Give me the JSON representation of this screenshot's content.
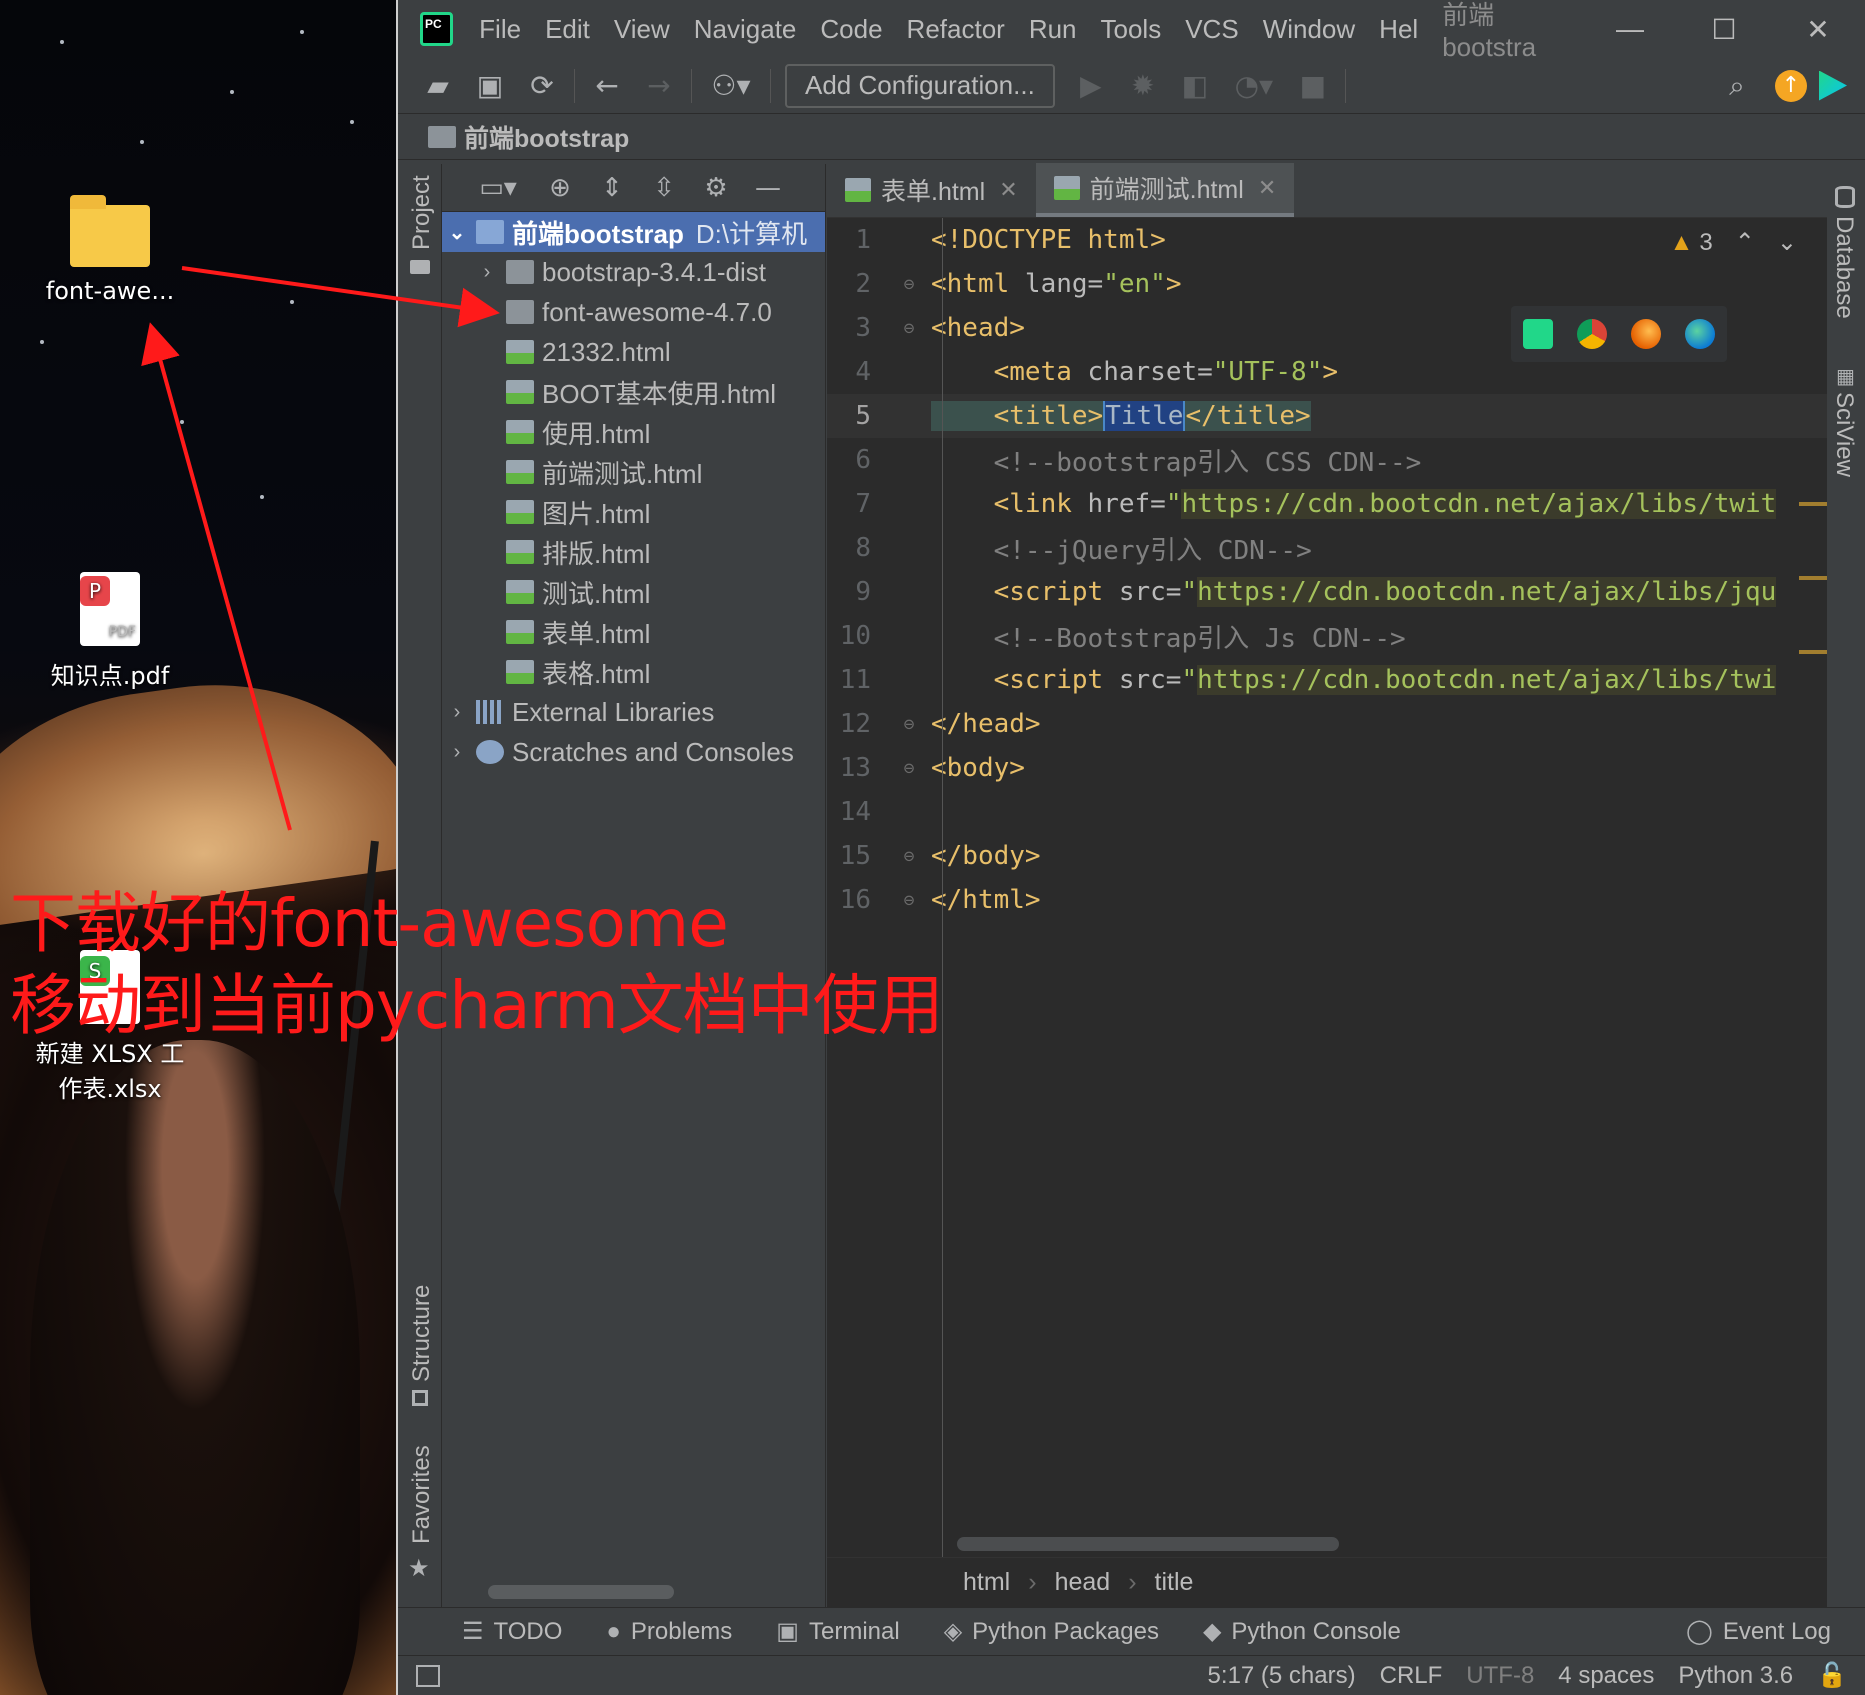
{
  "desktop": {
    "icons": [
      {
        "label": "font-awe..."
      },
      {
        "label": "知识点.pdf",
        "badge": "P",
        "type_label": "PDF"
      },
      {
        "label_line1": "新建 XLSX 工",
        "label_line2": "作表.xlsx",
        "badge": "S"
      }
    ],
    "annotation_line1": "下载好的font-awesome",
    "annotation_line2": "移动到当前pycharm文档中使用",
    "annotation_color": "#ff1a1a"
  },
  "titlebar": {
    "logo": "PC",
    "menu": [
      "File",
      "Edit",
      "View",
      "Navigate",
      "Code",
      "Refactor",
      "Run",
      "Tools",
      "VCS",
      "Window",
      "Hel"
    ],
    "window_title": "前端bootstra",
    "controls": [
      "—",
      "☐",
      "✕"
    ]
  },
  "toolbar": {
    "add_configuration": "Add Configuration...",
    "icons": [
      "open-folder-icon",
      "save-icon",
      "sync-icon",
      "back-icon",
      "forward-icon",
      "user-icon",
      "run-icon",
      "debug-icon",
      "coverage-icon",
      "profile-icon",
      "stop-icon",
      "search-icon",
      "update-icon"
    ]
  },
  "navbar": {
    "project": "前端bootstrap"
  },
  "left_stripe": {
    "project": "Project",
    "structure": "Structure",
    "favorites": "Favorites"
  },
  "right_stripe": {
    "database": "Database",
    "sciview": "SciView"
  },
  "project_tree": {
    "root": {
      "name": "前端bootstrap",
      "path": "D:\\计算机"
    },
    "items": [
      {
        "name": "bootstrap-3.4.1-dist"
      },
      {
        "name": "font-awesome-4.7.0"
      },
      {
        "name": "21332.html"
      },
      {
        "name": "BOOT基本使用.html"
      },
      {
        "name": "使用.html"
      },
      {
        "name": "前端测试.html"
      },
      {
        "name": "图片.html"
      },
      {
        "name": "排版.html"
      },
      {
        "name": "测试.html"
      },
      {
        "name": "表单.html"
      },
      {
        "name": "表格.html"
      },
      {
        "name": "External Libraries"
      },
      {
        "name": "Scratches and Consoles"
      }
    ]
  },
  "editor": {
    "tabs": [
      {
        "label": "表单.html",
        "close": "✕"
      },
      {
        "label": "前端测试.html",
        "close": "✕"
      }
    ],
    "warnings": "3",
    "line_numbers": [
      "1",
      "2",
      "3",
      "4",
      "5",
      "6",
      "7",
      "8",
      "9",
      "10",
      "11",
      "12",
      "13",
      "14",
      "15",
      "16"
    ],
    "lines": {
      "l1": "<!DOCTYPE html>",
      "l2a": "<html ",
      "l2b": "lang=",
      "l2c": "\"en\"",
      "l2d": ">",
      "l3": "<head>",
      "l4a": "    <meta ",
      "l4b": "charset=",
      "l4c": "\"UTF-8\"",
      "l4d": ">",
      "l5a": "    <title>",
      "l5b": "Title",
      "l5c": "</title>",
      "l6": "    <!--bootstrap引入 CSS CDN-->",
      "l7a": "    <link ",
      "l7b": "href=",
      "l7c": "\"",
      "l7d": "https://cdn.bootcdn.net/ajax/libs/twit",
      "l8": "    <!--jQuery引入 CDN-->",
      "l9a": "    <script ",
      "l9b": "src=",
      "l9c": "\"",
      "l9d": "https://cdn.bootcdn.net/ajax/libs/jqu",
      "l10": "    <!--Bootstrap引入 Js CDN-->",
      "l11a": "    <script ",
      "l11b": "src=",
      "l11c": "\"",
      "l11d": "https://cdn.bootcdn.net/ajax/libs/twi",
      "l12": "</head>",
      "l13": "<body>",
      "l14": "",
      "l15": "</body>",
      "l16": "</html>"
    },
    "breadcrumb": [
      "html",
      "head",
      "title"
    ],
    "breadcrumb_sep": "›"
  },
  "bottom_tools": [
    "TODO",
    "Problems",
    "Terminal",
    "Python Packages",
    "Python Console",
    "Event Log"
  ],
  "status": {
    "position": "5:17 (5 chars)",
    "line_sep": "CRLF",
    "encoding": "UTF-8",
    "indent": "4 spaces",
    "interpreter": "Python 3.6"
  },
  "colors": {
    "ide_bg": "#3c3f41",
    "editor_bg": "#2b2b2b",
    "selection": "#4b6eaf",
    "tag": "#e8bf6a",
    "string": "#a5c25c",
    "comment": "#808080"
  }
}
